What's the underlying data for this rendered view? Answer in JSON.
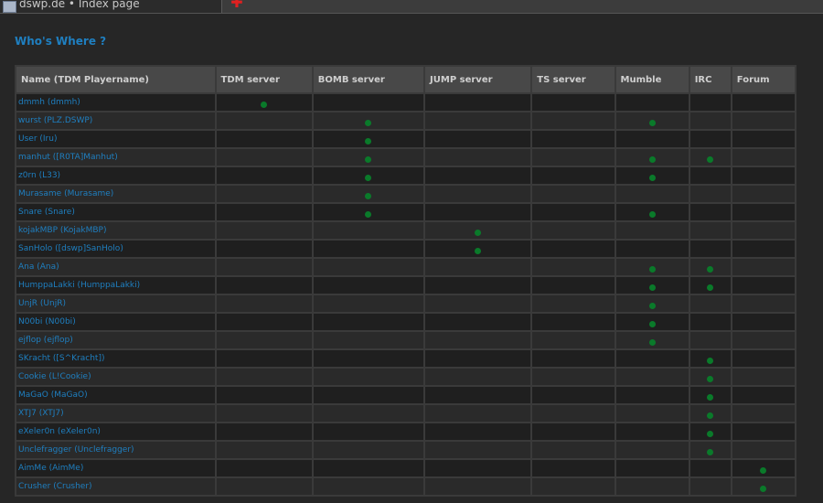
{
  "browser": {
    "tab_title": "dswp.de • Index page",
    "new_tab_glyph": "✚"
  },
  "page": {
    "heading": "Who's Where ?"
  },
  "columns": [
    "Name (TDM Playername)",
    "TDM server",
    "BOMB server",
    "JUMP server",
    "TS server",
    "Mumble",
    "IRC",
    "Forum"
  ],
  "rows": [
    {
      "name": "dmmh",
      "alias": "dmmh",
      "status": [
        true,
        false,
        false,
        false,
        false,
        false,
        false
      ]
    },
    {
      "name": "wurst",
      "alias": "PLZ.DSWP",
      "status": [
        false,
        true,
        false,
        false,
        true,
        false,
        false
      ]
    },
    {
      "name": "User",
      "alias": "Iru",
      "status": [
        false,
        true,
        false,
        false,
        false,
        false,
        false
      ]
    },
    {
      "name": "manhut",
      "alias": "[R0TA]Manhut",
      "status": [
        false,
        true,
        false,
        false,
        true,
        true,
        false
      ]
    },
    {
      "name": "z0rn",
      "alias": "L33",
      "status": [
        false,
        true,
        false,
        false,
        true,
        false,
        false
      ]
    },
    {
      "name": "Murasame",
      "alias": "Murasame",
      "status": [
        false,
        true,
        false,
        false,
        false,
        false,
        false
      ]
    },
    {
      "name": "Snare",
      "alias": "Snare",
      "status": [
        false,
        true,
        false,
        false,
        true,
        false,
        false
      ]
    },
    {
      "name": "kojakMBP",
      "alias": "KojakMBP",
      "status": [
        false,
        false,
        true,
        false,
        false,
        false,
        false
      ]
    },
    {
      "name": "SanHolo",
      "alias": "[dswp]SanHolo",
      "status": [
        false,
        false,
        true,
        false,
        false,
        false,
        false
      ]
    },
    {
      "name": "Ana",
      "alias": "Ana",
      "status": [
        false,
        false,
        false,
        false,
        true,
        true,
        false
      ]
    },
    {
      "name": "HumppaLakki",
      "alias": "HumppaLakki",
      "status": [
        false,
        false,
        false,
        false,
        true,
        true,
        false
      ]
    },
    {
      "name": "UnjR",
      "alias": "UnjR",
      "status": [
        false,
        false,
        false,
        false,
        true,
        false,
        false
      ]
    },
    {
      "name": "N00bi",
      "alias": "N00bi",
      "status": [
        false,
        false,
        false,
        false,
        true,
        false,
        false
      ]
    },
    {
      "name": "ejflop",
      "alias": "ejflop",
      "status": [
        false,
        false,
        false,
        false,
        true,
        false,
        false
      ]
    },
    {
      "name": "SKracht",
      "alias": "[S^Kracht]",
      "status": [
        false,
        false,
        false,
        false,
        false,
        true,
        false
      ]
    },
    {
      "name": "Cookie",
      "alias": "L!Cookie",
      "status": [
        false,
        false,
        false,
        false,
        false,
        true,
        false
      ]
    },
    {
      "name": "MaGaO",
      "alias": "MaGaO",
      "status": [
        false,
        false,
        false,
        false,
        false,
        true,
        false
      ]
    },
    {
      "name": "XTJ7",
      "alias": "XTJ7",
      "status": [
        false,
        false,
        false,
        false,
        false,
        true,
        false
      ]
    },
    {
      "name": "eXeler0n",
      "alias": "eXeler0n",
      "status": [
        false,
        false,
        false,
        false,
        false,
        true,
        false
      ]
    },
    {
      "name": "Unclefragger",
      "alias": "Unclefragger",
      "status": [
        false,
        false,
        false,
        false,
        false,
        true,
        false
      ]
    },
    {
      "name": "AimMe",
      "alias": "AimMe",
      "status": [
        false,
        false,
        false,
        false,
        false,
        false,
        true
      ]
    },
    {
      "name": "Crusher",
      "alias": "Crusher",
      "status": [
        false,
        false,
        false,
        false,
        false,
        false,
        true
      ]
    }
  ],
  "colors": {
    "link": "#1f7fc0",
    "online_dot": "#0a7a2a",
    "row_even": "#2a2a2a",
    "row_odd": "#1f1f1f"
  },
  "icons": {
    "tab_favicon": "page-favicon-icon",
    "new_tab": "plus-icon",
    "online": "green-dot-icon"
  }
}
